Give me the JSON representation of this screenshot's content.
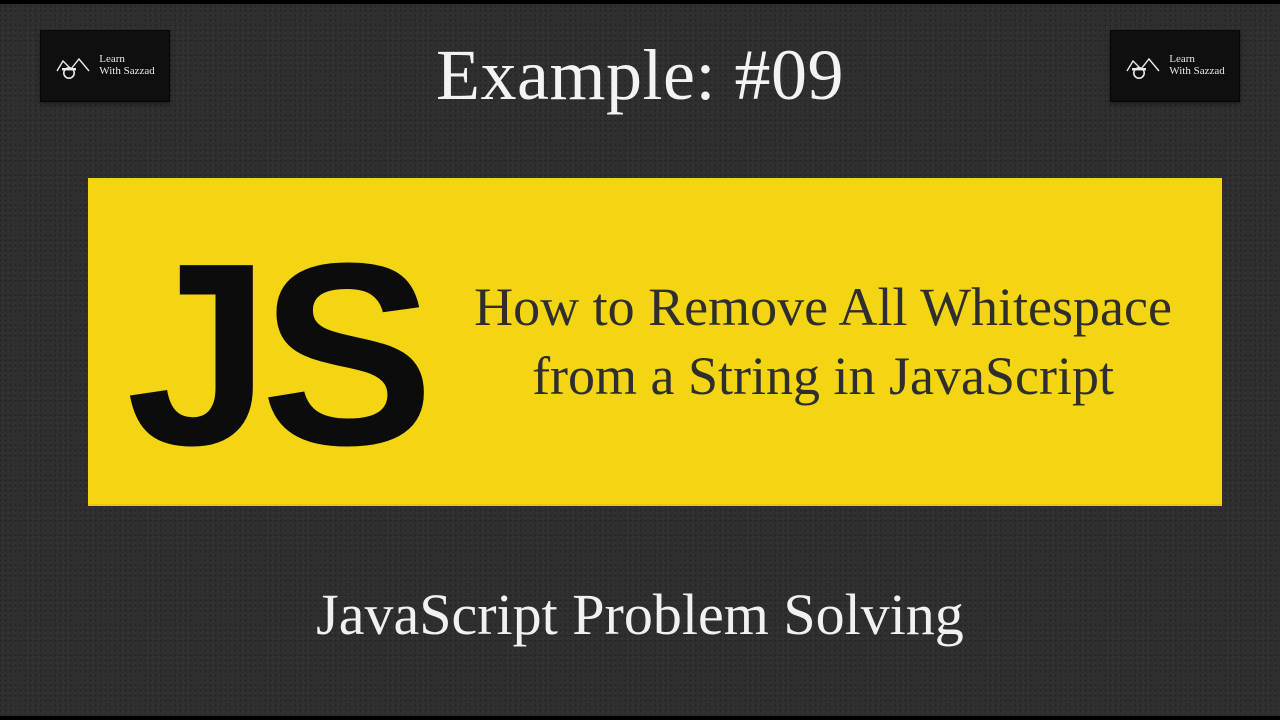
{
  "header": {
    "example_label": "Example: #09"
  },
  "logo": {
    "line1": "Learn",
    "line2": "With Sazzad"
  },
  "banner": {
    "badge": "JS",
    "title": "How to Remove All Whitespace from a String in JavaScript"
  },
  "footer": {
    "text": "JavaScript Problem Solving"
  }
}
